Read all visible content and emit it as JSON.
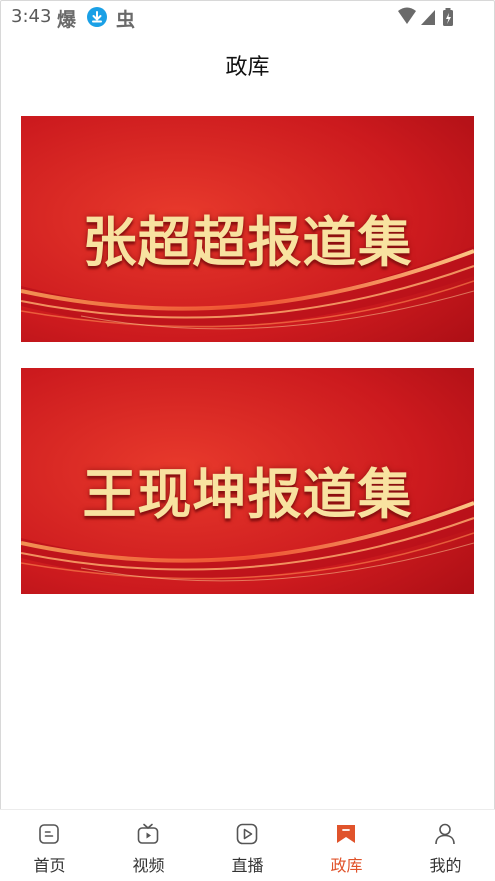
{
  "status_bar": {
    "time": "3:43",
    "app_glyph_1": "爆",
    "app_glyph_2": "虫"
  },
  "page": {
    "title": "政库"
  },
  "banners": [
    {
      "title": "张超超报道集"
    },
    {
      "title": "王现坤报道集"
    }
  ],
  "tabs": [
    {
      "label": "首页",
      "icon": "home-icon"
    },
    {
      "label": "视频",
      "icon": "tv-icon"
    },
    {
      "label": "直播",
      "icon": "play-icon"
    },
    {
      "label": "政库",
      "icon": "bookmark-icon",
      "active": true
    },
    {
      "label": "我的",
      "icon": "person-icon"
    }
  ],
  "colors": {
    "accent": "#e0532b",
    "banner_red": "#c8141c",
    "banner_text": "#f8e2a0"
  }
}
